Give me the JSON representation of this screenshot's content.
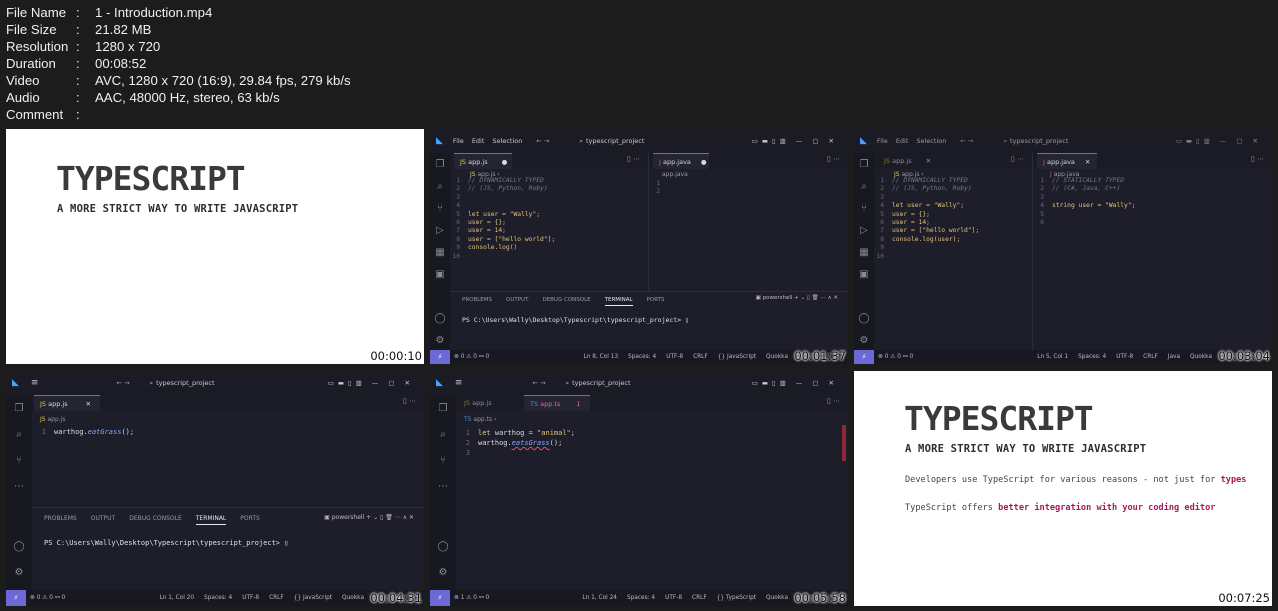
{
  "file_info": {
    "rows": [
      {
        "key": "File Name",
        "value": "1 - Introduction.mp4"
      },
      {
        "key": "File Size",
        "value": "21.82 MB"
      },
      {
        "key": "Resolution",
        "value": "1280 x 720"
      },
      {
        "key": "Duration",
        "value": "00:08:52"
      },
      {
        "key": "Video",
        "value": "AVC, 1280 x 720 (16:9), 29.84 fps, 279 kb/s"
      },
      {
        "key": "Audio",
        "value": "AAC, 48000 Hz, stereo, 63 kb/s"
      },
      {
        "key": "Comment",
        "value": ""
      }
    ],
    "separator": ":"
  },
  "thumbnails": [
    {
      "timestamp": "00:00:10",
      "title": "TYPESCRIPT",
      "subtitle": "A MORE STRICT WAY TO WRITE JAVASCRIPT"
    },
    {
      "timestamp": "00:01:37",
      "menu": [
        "File",
        "Edit",
        "Selection"
      ],
      "search": "typescript_project",
      "left_tab": "app.js",
      "right_tab": "app.java",
      "left_crumb": "app.js",
      "right_crumb": "app.java",
      "code_left": {
        "comment1": "// DYNAMICALLY TYPED",
        "comment2": "// (JS, Python, Ruby)",
        "line5": "let user = \"Wally\";",
        "line6": "user = {};",
        "line7": "user = 14;",
        "line8": "user = [\"hello world\"];",
        "line9": "console.log()"
      },
      "panel_tabs": [
        "PROBLEMS",
        "OUTPUT",
        "DEBUG CONSOLE",
        "TERMINAL",
        "PORTS"
      ],
      "shell": "powershell",
      "prompt": "PS C:\\Users\\Wally\\Desktop\\Typescript\\typescript_project>",
      "status": {
        "errors": "0",
        "warnings": "0",
        "ports": "0",
        "position": "Ln 8, Col 13",
        "spaces": "Spaces: 4",
        "encoding": "UTF-8",
        "eol": "CRLF",
        "language": "JavaScript",
        "ext": "Quokka"
      }
    },
    {
      "timestamp": "00:03:04",
      "menu": [
        "File",
        "Edit",
        "Selection"
      ],
      "search": "typescript_project",
      "left_tab": "app.js",
      "right_tab": "app.java",
      "left_crumb": "app.js",
      "right_crumb": "app.java",
      "code_left": {
        "comment1": "// DYNAMICALLY TYPED",
        "comment2": "// (JS, Python, Ruby)",
        "line5": "let user = \"Wally\";",
        "line6": "user = {};",
        "line7": "user = 14;",
        "line8": "user = [\"hello world\"];",
        "line9": "console.log(user);"
      },
      "code_right": {
        "comment1": "// STATICALLY TYPED",
        "comment2": "// (C#, Java, C++)",
        "line4": "string user = \"Wally\";"
      },
      "status": {
        "errors": "0",
        "warnings": "0",
        "ports": "0",
        "position": "Ln 5, Col 1",
        "spaces": "Spaces: 4",
        "encoding": "UTF-8",
        "eol": "CRLF",
        "language": "Java",
        "ext": "Quokka"
      }
    },
    {
      "timestamp": "00:04:31",
      "search": "typescript_project",
      "tab": "app.js",
      "crumb": "app.js",
      "code": {
        "obj": "warthog",
        "method": "eatGrass",
        "rest": "();"
      },
      "panel_tabs": [
        "PROBLEMS",
        "OUTPUT",
        "DEBUG CONSOLE",
        "TERMINAL",
        "PORTS"
      ],
      "shell": "powershell",
      "prompt": "PS C:\\Users\\Wally\\Desktop\\Typescript\\typescript_project>",
      "status": {
        "errors": "0",
        "warnings": "0",
        "ports": "0",
        "position": "Ln 1, Col 20",
        "spaces": "Spaces: 4",
        "encoding": "UTF-8",
        "eol": "CRLF",
        "language": "JavaScript",
        "ext": "Quokka"
      }
    },
    {
      "timestamp": "00:05:58",
      "search": "typescript_project",
      "tab1": "app.js",
      "tab2": "app.ts",
      "tab2_badge": "1",
      "crumb": "app.ts",
      "code": {
        "l1_kw": "let",
        "l1_id": "warthog",
        "l1_eq": " = ",
        "l1_str": "\"animal\"",
        "l1_end": ";",
        "l2_obj": "warthog.",
        "l2_method": "eatsGrass",
        "l2_end": "();"
      },
      "status": {
        "errors": "1",
        "warnings": "0",
        "ports": "0",
        "position": "Ln 1, Col 24",
        "spaces": "Spaces: 4",
        "encoding": "UTF-8",
        "eol": "CRLF",
        "language": "TypeScript",
        "ext": "Quokka"
      }
    },
    {
      "timestamp": "00:07:25",
      "title": "TYPESCRIPT",
      "subtitle": "A MORE STRICT WAY TO WRITE JAVASCRIPT",
      "line1_pre": "Developers use TypeScript for various reasons - not just for ",
      "line1_hl": "types",
      "line2_pre": "TypeScript offers ",
      "line2_hl": "better integration with your coding editor"
    }
  ],
  "colors": {
    "accent": "#6b69d6",
    "highlight": "#a8195b"
  }
}
